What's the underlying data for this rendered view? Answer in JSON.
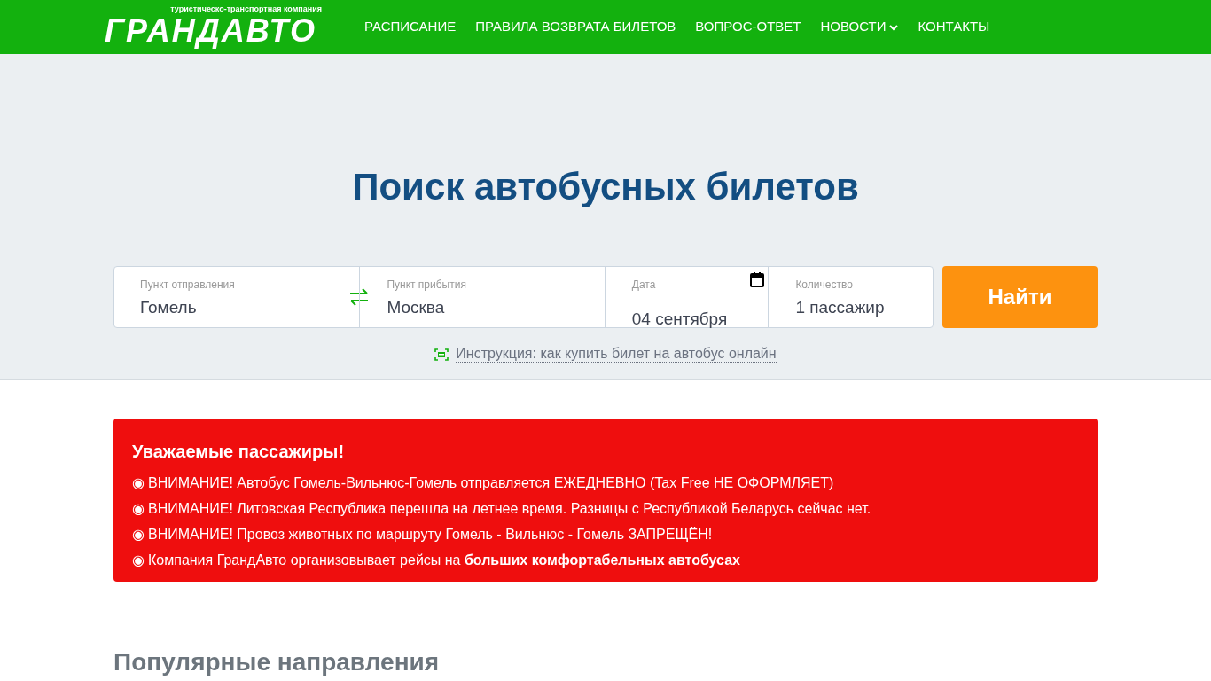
{
  "header": {
    "logo": {
      "tagline": "туристическо-транспортная компания",
      "name": "ГРАНДАВТО"
    },
    "nav": [
      {
        "label": "РАСПИСАНИЕ",
        "dropdown": false
      },
      {
        "label": "ПРАВИЛА ВОЗВРАТА БИЛЕТОВ",
        "dropdown": false
      },
      {
        "label": "ВОПРОС-ОТВЕТ",
        "dropdown": false
      },
      {
        "label": "НОВОСТИ",
        "dropdown": true
      },
      {
        "label": "КОНТАКТЫ",
        "dropdown": false
      }
    ]
  },
  "search": {
    "title": "Поиск автобусных билетов",
    "fields": [
      {
        "kind": "from",
        "label": "Пункт отправления",
        "value": "Гомель"
      },
      {
        "kind": "to",
        "label": "Пункт прибытия",
        "value": "Москва"
      },
      {
        "kind": "date",
        "label": "Дата",
        "value": "04 сентября"
      },
      {
        "kind": "count",
        "label": "Количество",
        "value": "1 пассажир"
      }
    ],
    "button": "Найти",
    "instruction_link": "Инструкция: как купить билет на автобус онлайн"
  },
  "notice": {
    "title": "Уважаемые пассажиры!",
    "bullet": "◉",
    "items": [
      "ВНИМАНИЕ! Автобус Гомель-Вильнюс-Гомель отправляется ЕЖЕДНЕВНО (Tax Free НЕ ОФОРМЛЯЕТ)",
      "ВНИМАНИЕ! Литовская Республика перешла на летнее время. Разницы с Республикой Беларусь сейчас нет.",
      "ВНИМАНИЕ! Провоз животных по маршруту Гомель - Вильнюс - Гомель ЗАПРЕЩЁН!",
      "Компания ГрандАвто организовывает рейсы на **больших комфортабельных автобусах**"
    ]
  },
  "popular": {
    "title": "Популярные направления"
  }
}
